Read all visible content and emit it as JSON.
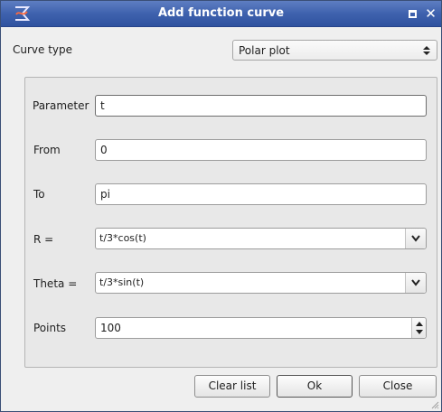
{
  "window": {
    "title": "Add function curve",
    "close_glyph": "✕",
    "icons": {
      "app": "app-icon",
      "maximize": "maximize-icon",
      "close": "close-icon"
    }
  },
  "curve_type": {
    "label": "Curve type",
    "value": "Polar plot"
  },
  "form": {
    "parameter": {
      "label": "Parameter",
      "value": "t"
    },
    "from": {
      "label": "From",
      "value": "0"
    },
    "to": {
      "label": "To",
      "value": "pi"
    },
    "r": {
      "label": "R =",
      "value": "t/3*cos(t)"
    },
    "theta": {
      "label": "Theta =",
      "value": "t/3*sin(t)"
    },
    "points": {
      "label": "Points",
      "value": "100"
    }
  },
  "buttons": {
    "clear_list": "Clear list",
    "ok": "Ok",
    "close": "Close"
  },
  "colors": {
    "titlebar": "#3f62ae",
    "window_bg": "#efefef",
    "panel_bg": "#e8e8e8",
    "focus_border": "#6e6e6e"
  }
}
